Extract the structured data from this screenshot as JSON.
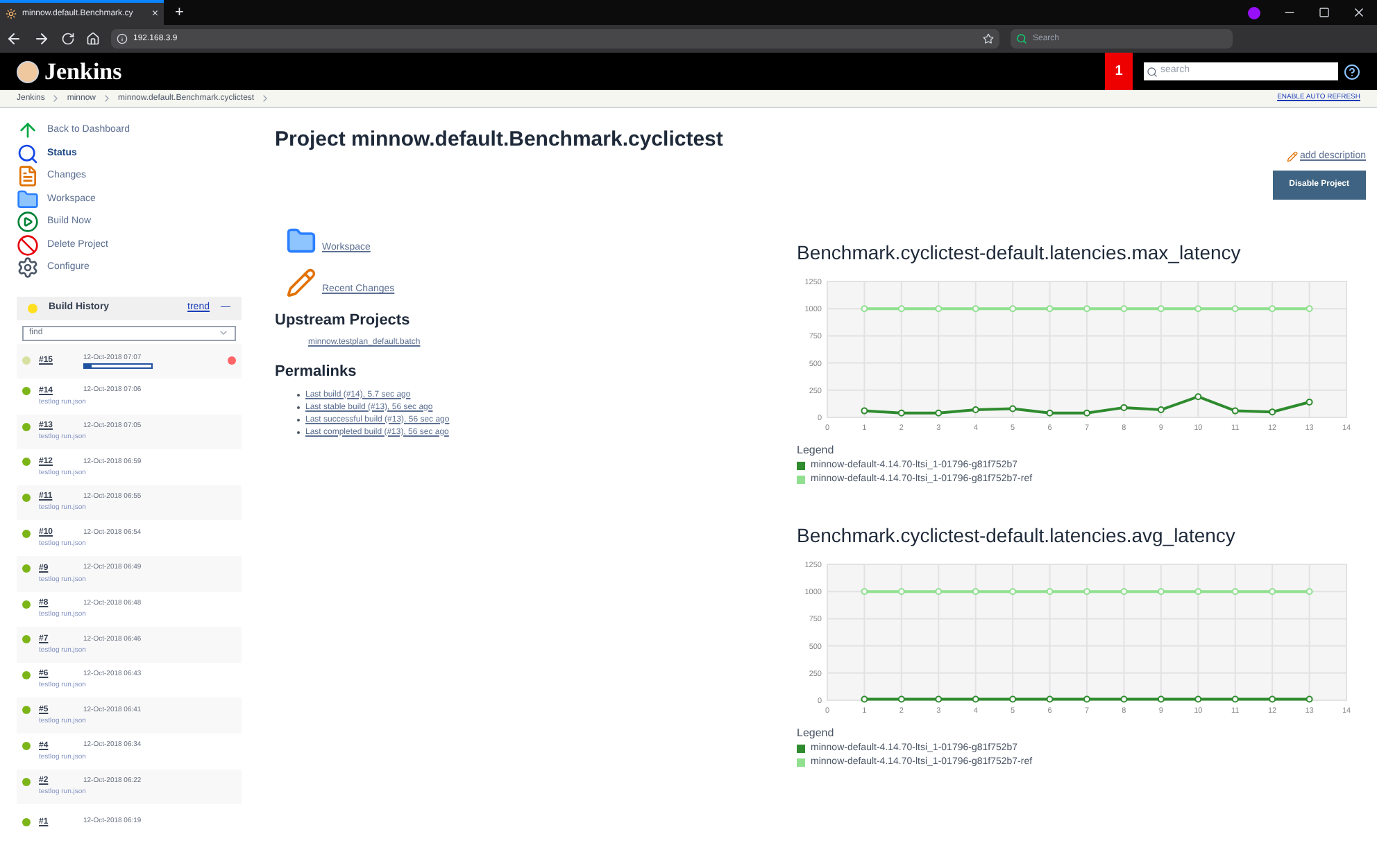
{
  "browser": {
    "tab_title": "minnow.default.Benchmark.cy",
    "tab_close": "×",
    "new_tab": "+",
    "url": "192.168.3.9",
    "search_placeholder": "Search"
  },
  "header": {
    "logo": "Jenkins",
    "notification_count": "1",
    "search_placeholder": "search"
  },
  "breadcrumbs": [
    "Jenkins",
    "minnow",
    "minnow.default.Benchmark.cyclictest"
  ],
  "auto_refresh": "ENABLE AUTO REFRESH",
  "sidebar": {
    "tasks": [
      {
        "label": "Back to Dashboard",
        "kind": "dashboard",
        "selected": false
      },
      {
        "label": "Status",
        "kind": "status",
        "selected": true
      },
      {
        "label": "Changes",
        "kind": "changes",
        "selected": false
      },
      {
        "label": "Workspace",
        "kind": "workspace",
        "selected": false
      },
      {
        "label": "Build Now",
        "kind": "build",
        "selected": false
      },
      {
        "label": "Delete Project",
        "kind": "delete",
        "selected": false
      },
      {
        "label": "Configure",
        "kind": "configure",
        "selected": false
      }
    ]
  },
  "build_history": {
    "title": "Build History",
    "trend": "trend",
    "trend_mark": "—",
    "find_placeholder": "find",
    "builds": [
      {
        "number": "#15",
        "time": "12-Oct-2018 07:07",
        "kind": "running",
        "level": 0.1
      },
      {
        "number": "#14",
        "time": "12-Oct-2018 07:06",
        "kind": "success",
        "link": "testlog run.json"
      },
      {
        "number": "#13",
        "time": "12-Oct-2018 07:05",
        "kind": "success",
        "link": "testlog run.json"
      },
      {
        "number": "#12",
        "time": "12-Oct-2018 06:59",
        "kind": "success",
        "link": "testlog run.json"
      },
      {
        "number": "#11",
        "time": "12-Oct-2018 06:55",
        "kind": "success",
        "link": "testlog run.json"
      },
      {
        "number": "#10",
        "time": "12-Oct-2018 06:54",
        "kind": "success",
        "link": "testlog run.json"
      },
      {
        "number": "#9",
        "time": "12-Oct-2018 06:49",
        "kind": "success",
        "link": "testlog run.json"
      },
      {
        "number": "#8",
        "time": "12-Oct-2018 06:48",
        "kind": "success",
        "link": "testlog run.json"
      },
      {
        "number": "#7",
        "time": "12-Oct-2018 06:46",
        "kind": "success",
        "link": "testlog run.json"
      },
      {
        "number": "#6",
        "time": "12-Oct-2018 06:43",
        "kind": "success",
        "link": "testlog run.json"
      },
      {
        "number": "#5",
        "time": "12-Oct-2018 06:41",
        "kind": "success",
        "link": "testlog run.json"
      },
      {
        "number": "#4",
        "time": "12-Oct-2018 06:34",
        "kind": "success",
        "link": "testlog run.json"
      },
      {
        "number": "#2",
        "time": "12-Oct-2018 06:22",
        "kind": "success",
        "link": "testlog run.json"
      },
      {
        "number": "#1",
        "time": "12-Oct-2018 06:19",
        "kind": "success"
      }
    ]
  },
  "main": {
    "title": "Project minnow.default.Benchmark.cyclictest",
    "add_description": "add description",
    "disable_button": "Disable Project",
    "links": [
      {
        "label": "Workspace",
        "kind": "workspace"
      },
      {
        "label": "Recent Changes",
        "kind": "changes"
      }
    ],
    "upstream_title": "Upstream Projects",
    "upstream": [
      "minnow.testplan_default.batch"
    ],
    "permalinks_title": "Permalinks",
    "permalinks": [
      "Last build (#14), 5.7 sec ago",
      "Last stable build (#13), 56 sec ago",
      "Last successful build (#13), 56 sec ago",
      "Last completed build (#13), 56 sec ago"
    ]
  },
  "charts": [
    {
      "title": "Benchmark.cyclictest-default.latencies.max_latency",
      "chart_data": {
        "type": "line",
        "grid": true,
        "legend": {
          "title": "Legend"
        },
        "x": [
          1,
          2,
          3,
          4,
          5,
          6,
          7,
          8,
          9,
          10,
          11,
          12,
          13
        ],
        "xlim": [
          0,
          14
        ],
        "ylim": [
          0,
          1250
        ],
        "xticks": [
          0,
          1,
          2,
          3,
          4,
          5,
          6,
          7,
          8,
          9,
          10,
          11,
          12,
          13,
          14
        ],
        "yticks": [
          0,
          250,
          500,
          750,
          1000,
          1250
        ],
        "series": [
          {
            "name": "minnow-default-4.14.70-ltsi_1-01796-g81f752b7",
            "color": "#2e8b2e",
            "marker": "circle",
            "values": [
              60,
              40,
              40,
              70,
              80,
              40,
              40,
              90,
              70,
              190,
              60,
              50,
              140
            ]
          },
          {
            "name": "minnow-default-4.14.70-ltsi_1-01796-g81f752b7-ref",
            "color": "#90e090",
            "marker": "circle",
            "values": [
              1000,
              1000,
              1000,
              1000,
              1000,
              1000,
              1000,
              1000,
              1000,
              1000,
              1000,
              1000,
              1000
            ]
          }
        ]
      }
    },
    {
      "title": "Benchmark.cyclictest-default.latencies.avg_latency",
      "chart_data": {
        "type": "line",
        "grid": true,
        "legend": {
          "title": "Legend"
        },
        "x": [
          1,
          2,
          3,
          4,
          5,
          6,
          7,
          8,
          9,
          10,
          11,
          12,
          13
        ],
        "xlim": [
          0,
          14
        ],
        "ylim": [
          0,
          1250
        ],
        "xticks": [
          0,
          1,
          2,
          3,
          4,
          5,
          6,
          7,
          8,
          9,
          10,
          11,
          12,
          13,
          14
        ],
        "yticks": [
          0,
          250,
          500,
          750,
          1000,
          1250
        ],
        "series": [
          {
            "name": "minnow-default-4.14.70-ltsi_1-01796-g81f752b7",
            "color": "#2e8b2e",
            "marker": "circle",
            "values": [
              10,
              10,
              10,
              10,
              10,
              10,
              10,
              10,
              10,
              10,
              10,
              10,
              10
            ]
          },
          {
            "name": "minnow-default-4.14.70-ltsi_1-01796-g81f752b7-ref",
            "color": "#90e090",
            "marker": "circle",
            "values": [
              1000,
              1000,
              1000,
              1000,
              1000,
              1000,
              1000,
              1000,
              1000,
              1000,
              1000,
              1000,
              1000
            ]
          }
        ]
      }
    }
  ]
}
